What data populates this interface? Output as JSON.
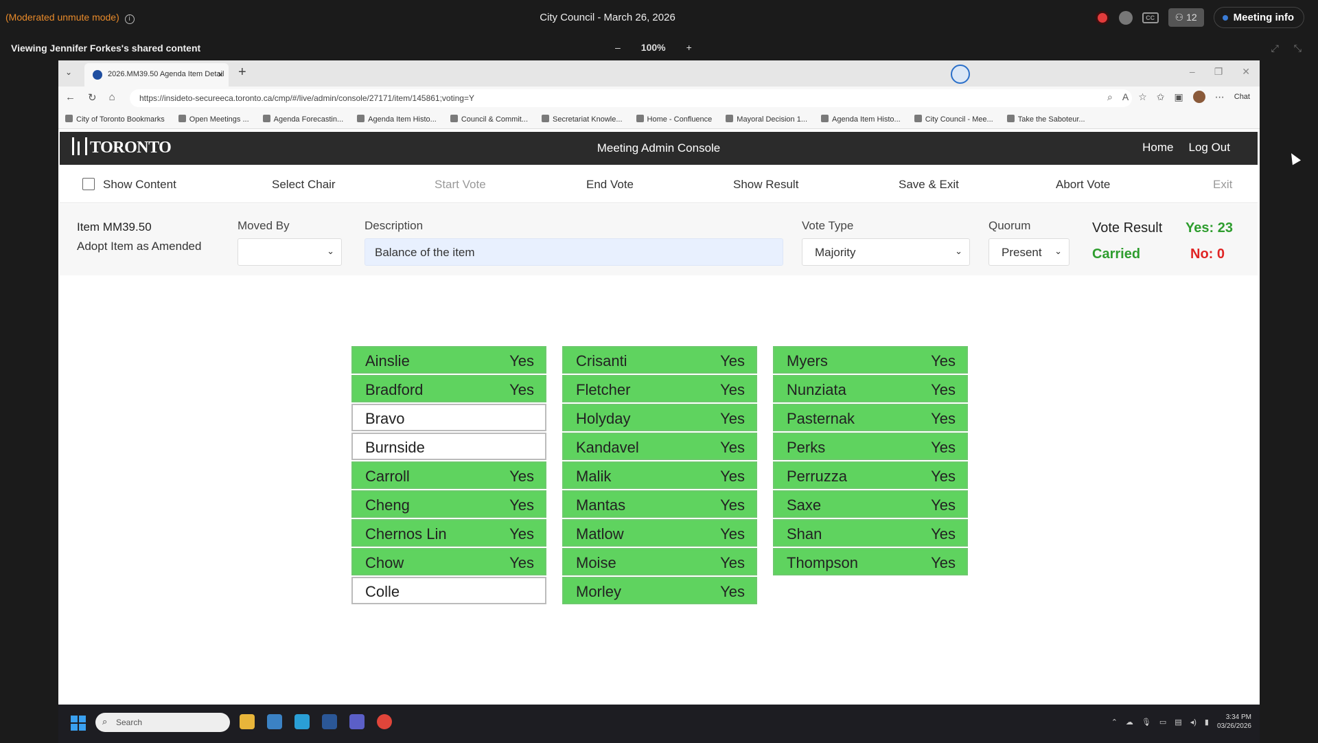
{
  "meeting": {
    "mode_label": "(Moderated unmute mode)",
    "info_glyph": "i",
    "title": "City Council - March 26, 2026",
    "participants_count": "12",
    "meeting_info_label": "Meeting info",
    "cc_label": "CC"
  },
  "share": {
    "viewing_text": "Viewing Jennifer Forkes's shared content",
    "zoom_out": "–",
    "zoom_value": "100%",
    "zoom_in": "+"
  },
  "browser": {
    "tab_title": "2026.MM39.50 Agenda Item Detail",
    "tab_close": "×",
    "new_tab": "+",
    "url": "https://insideto-secureeca.toronto.ca/cmp/#/live/admin/console/27171/item/145861;voting=Y",
    "copilot_label": "Chat",
    "bookmarks": [
      "City of Toronto Bookmarks",
      "Open Meetings ...",
      "Agenda Forecastin...",
      "Agenda Item Histo...",
      "Council & Commit...",
      "Secretariat Knowle...",
      "Home - Confluence",
      "Mayoral Decision 1...",
      "Agenda Item Histo...",
      "City Council - Mee...",
      "Take the Saboteur..."
    ]
  },
  "app": {
    "logo_text": "TORONTO",
    "title": "Meeting Admin Console",
    "nav": {
      "home": "Home",
      "logout": "Log Out"
    },
    "toolbar": {
      "show_content": "Show Content",
      "select_chair": "Select Chair",
      "start_vote": "Start Vote",
      "end_vote": "End Vote",
      "show_result": "Show Result",
      "save_exit": "Save & Exit",
      "abort_vote": "Abort Vote",
      "exit": "Exit"
    },
    "item": {
      "id": "Item MM39.50",
      "motion": "Adopt Item as Amended",
      "moved_by_label": "Moved By",
      "moved_by_value": "",
      "description_label": "Description",
      "description_value": "Balance of the item",
      "vote_type_label": "Vote Type",
      "vote_type_value": "Majority",
      "quorum_label": "Quorum",
      "quorum_value": "Present"
    },
    "result": {
      "label": "Vote Result",
      "status": "Carried",
      "yes": "Yes: 23",
      "no": "No: 0"
    },
    "votes": [
      [
        {
          "name": "Ainslie",
          "vote": "Yes"
        },
        {
          "name": "Bradford",
          "vote": "Yes"
        },
        {
          "name": "Bravo",
          "vote": ""
        },
        {
          "name": "Burnside",
          "vote": ""
        },
        {
          "name": "Carroll",
          "vote": "Yes"
        },
        {
          "name": "Cheng",
          "vote": "Yes"
        },
        {
          "name": "Chernos Lin",
          "vote": "Yes"
        },
        {
          "name": "Chow",
          "vote": "Yes"
        },
        {
          "name": "Colle",
          "vote": ""
        }
      ],
      [
        {
          "name": "Crisanti",
          "vote": "Yes"
        },
        {
          "name": "Fletcher",
          "vote": "Yes"
        },
        {
          "name": "Holyday",
          "vote": "Yes"
        },
        {
          "name": "Kandavel",
          "vote": "Yes"
        },
        {
          "name": "Malik",
          "vote": "Yes"
        },
        {
          "name": "Mantas",
          "vote": "Yes"
        },
        {
          "name": "Matlow",
          "vote": "Yes"
        },
        {
          "name": "Moise",
          "vote": "Yes"
        },
        {
          "name": "Morley",
          "vote": "Yes"
        }
      ],
      [
        {
          "name": "Myers",
          "vote": "Yes"
        },
        {
          "name": "Nunziata",
          "vote": "Yes"
        },
        {
          "name": "Pasternak",
          "vote": "Yes"
        },
        {
          "name": "Perks",
          "vote": "Yes"
        },
        {
          "name": "Perruzza",
          "vote": "Yes"
        },
        {
          "name": "Saxe",
          "vote": "Yes"
        },
        {
          "name": "Shan",
          "vote": "Yes"
        },
        {
          "name": "Thompson",
          "vote": "Yes"
        }
      ]
    ]
  },
  "taskbar": {
    "search_placeholder": "Search",
    "time": "3:34 PM",
    "date": "03/26/2026"
  },
  "colors": {
    "vote_yes": "#5fd35f",
    "carried": "#2e9d2e",
    "no": "#e02424",
    "moderated": "#e88a2a"
  }
}
